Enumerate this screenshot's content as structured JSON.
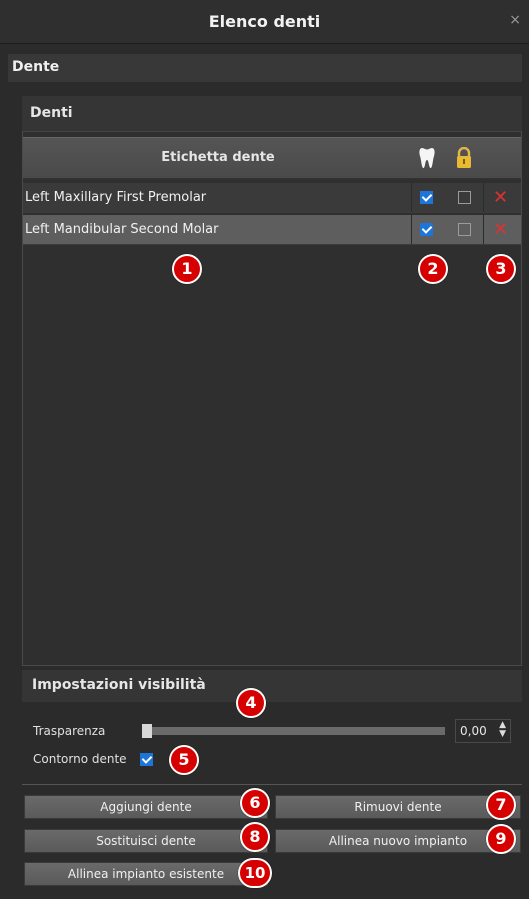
{
  "window": {
    "title": "Elenco denti",
    "close_glyph": "×"
  },
  "section": {
    "label": "Dente"
  },
  "panel": {
    "label": "Denti"
  },
  "table": {
    "header": {
      "label_col": "Etichetta dente",
      "visibility_icon": "tooth-icon",
      "lock_icon": "lock-icon"
    },
    "rows": [
      {
        "name": "Left Maxillary First Premolar",
        "visible": true,
        "locked": false,
        "selected": false
      },
      {
        "name": "Left Mandibular Second Molar",
        "visible": true,
        "locked": false,
        "selected": true
      }
    ],
    "delete_glyph": "✕"
  },
  "callouts": [
    "1",
    "2",
    "3",
    "4",
    "5",
    "6",
    "7",
    "8",
    "9",
    "10"
  ],
  "visibility": {
    "label": "Impostazioni visibilità",
    "transparency_label": "Trasparenza",
    "transparency_value": "0,00",
    "transparency_level": 0,
    "contour_label": "Contorno dente",
    "contour_checked": true
  },
  "buttons": {
    "add": "Aggiungi dente",
    "remove": "Rimuovi dente",
    "replace": "Sostituisci dente",
    "align_new": "Allinea nuovo impianto",
    "align_existing": "Allinea impianto esistente"
  },
  "colors": {
    "accent": "#1c75d8",
    "callout": "#d70000",
    "delete": "#e03131"
  }
}
